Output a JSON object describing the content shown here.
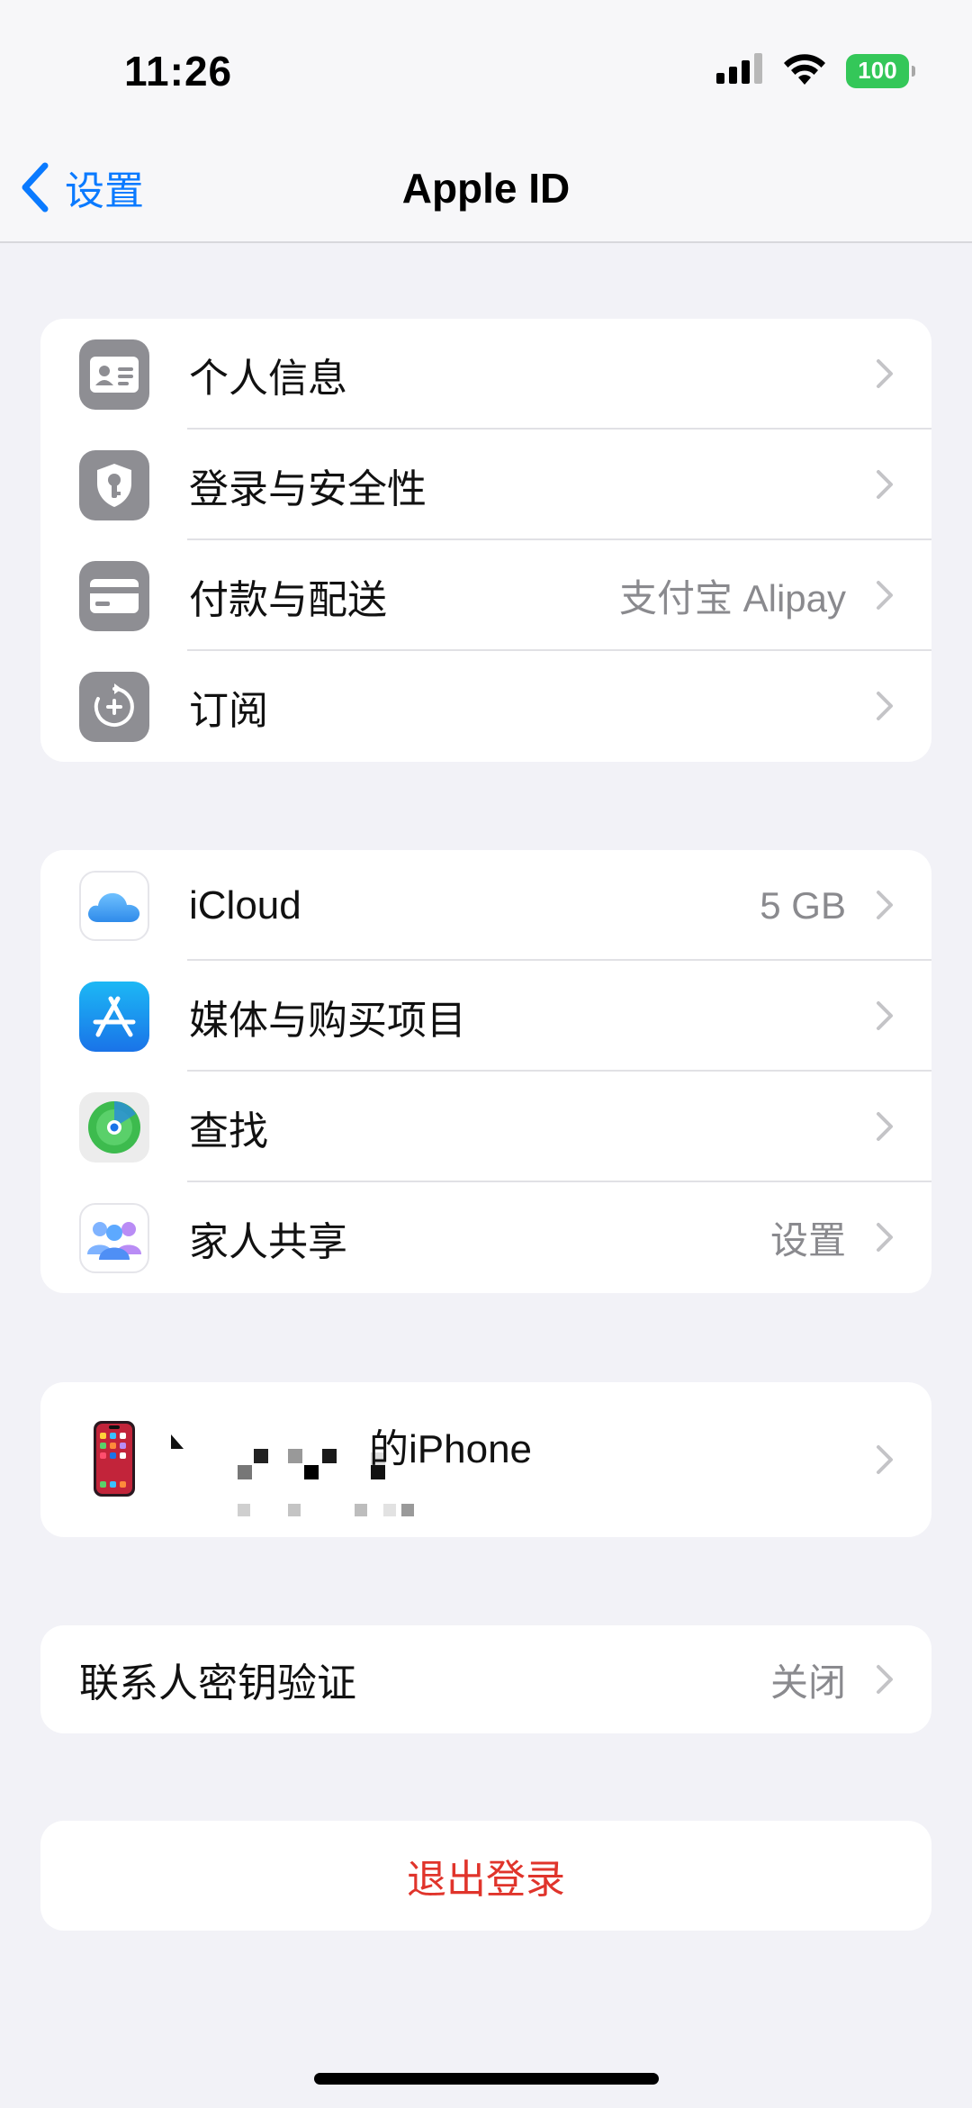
{
  "status_bar": {
    "time": "11:26",
    "battery": "100"
  },
  "nav": {
    "back_label": "设置",
    "title": "Apple ID"
  },
  "groups": {
    "account": [
      {
        "label": "个人信息",
        "value": "",
        "icon": "person-card-icon"
      },
      {
        "label": "登录与安全性",
        "value": "",
        "icon": "shield-key-icon"
      },
      {
        "label": "付款与配送",
        "value": "支付宝 Alipay",
        "icon": "credit-card-icon"
      },
      {
        "label": "订阅",
        "value": "",
        "icon": "subscription-plus-icon"
      }
    ],
    "services": [
      {
        "label": "iCloud",
        "value": "5 GB",
        "icon": "icloud-icon"
      },
      {
        "label": "媒体与购买项目",
        "value": "",
        "icon": "app-store-icon"
      },
      {
        "label": "查找",
        "value": "",
        "icon": "find-my-icon"
      },
      {
        "label": "家人共享",
        "value": "设置",
        "icon": "family-sharing-icon"
      }
    ],
    "device": {
      "name": "的iPhone",
      "icon": "iphone-icon"
    },
    "contact_key": {
      "label": "联系人密钥验证",
      "value": "关闭"
    },
    "sign_out": "退出登录"
  },
  "colors": {
    "accent": "#0a7aff",
    "destructive": "#e0342b",
    "background": "#f2f2f7",
    "battery": "#34c759"
  }
}
